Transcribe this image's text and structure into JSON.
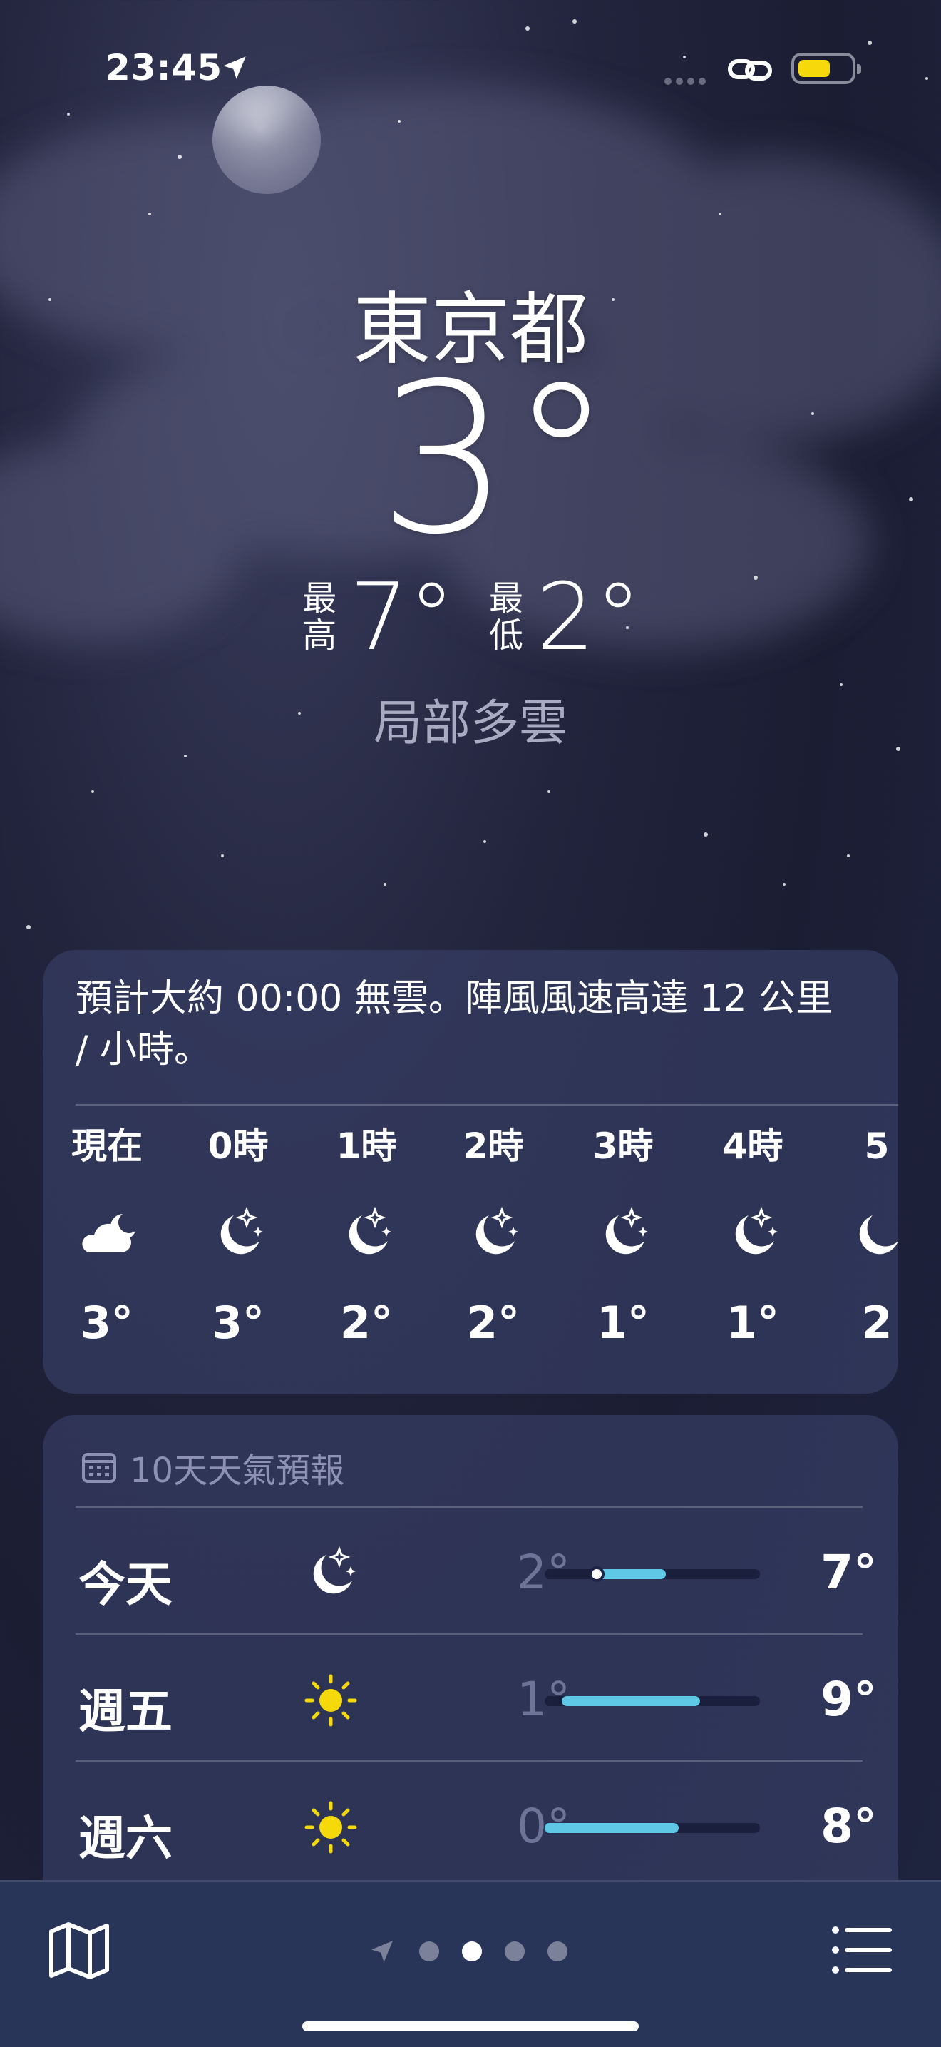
{
  "status_bar": {
    "time": "23:45"
  },
  "weather": {
    "city": "東京都",
    "current_temp": "3°",
    "high_label": "最\n高",
    "high": "7°",
    "low_label": "最\n低",
    "low": "2°",
    "condition": "局部多雲"
  },
  "hourly_card": {
    "summary": "預計大約 00:00 無雲。陣風風速高達 12 公里 / 小時。",
    "hours": [
      {
        "label": "現在",
        "icon": "cloud-moon-icon",
        "temp": "3°"
      },
      {
        "label": "0時",
        "icon": "moon-stars-icon",
        "temp": "3°"
      },
      {
        "label": "1時",
        "icon": "moon-stars-icon",
        "temp": "2°"
      },
      {
        "label": "2時",
        "icon": "moon-stars-icon",
        "temp": "2°"
      },
      {
        "label": "3時",
        "icon": "moon-stars-icon",
        "temp": "1°"
      },
      {
        "label": "4時",
        "icon": "moon-stars-icon",
        "temp": "1°"
      },
      {
        "label": "5",
        "icon": "moon-stars-icon",
        "temp": "2"
      }
    ]
  },
  "forecast_card": {
    "header": "10天天氣預報",
    "days": [
      {
        "day": "今天",
        "icon": "moon-stars-icon",
        "low": "2°",
        "high": "7°",
        "range_start": 0.24,
        "range_end": 0.56,
        "current": 0.24
      },
      {
        "day": "週五",
        "icon": "sun-icon",
        "low": "1°",
        "high": "9°",
        "range_start": 0.08,
        "range_end": 0.72
      },
      {
        "day": "週六",
        "icon": "sun-icon",
        "low": "0°",
        "high": "8°",
        "range_start": 0.0,
        "range_end": 0.62
      }
    ]
  },
  "tab_bar": {
    "pages": 4,
    "active_page": 2
  },
  "colors": {
    "accent_bar": "#5ec8e6",
    "sun": "#f5d90a",
    "battery": "#f5d90a"
  }
}
